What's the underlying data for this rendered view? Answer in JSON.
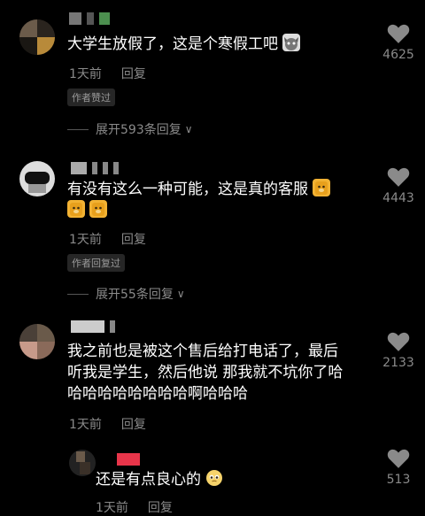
{
  "comments": [
    {
      "text": "大学生放假了，这是个寒假工吧",
      "emoji": "cat-face",
      "time": "1天前",
      "reply_label": "回复",
      "tag": "作者赞过",
      "expand_label": "展开593条回复",
      "likes": "4625"
    },
    {
      "text": "有没有这么一种可能，这是真的客服",
      "emoji": "dog-face",
      "time": "1天前",
      "reply_label": "回复",
      "tag": "作者回复过",
      "expand_label": "展开55条回复",
      "likes": "4443"
    },
    {
      "text_line1": "我之前也是被这个售后给打电话了，最后",
      "text_line2": "听我是学生，然后他说 那我就不坑你了哈",
      "text_line3": "哈哈哈哈哈哈哈哈啊哈哈哈",
      "time": "1天前",
      "reply_label": "回复",
      "likes": "2133"
    },
    {
      "text": "还是有点良心的",
      "emoji": "pleading-face",
      "time": "1天前",
      "reply_label": "回复",
      "likes": "513"
    }
  ],
  "colors": {
    "background": "#000000",
    "text": "#ffffff",
    "muted": "#8a8a8a"
  }
}
